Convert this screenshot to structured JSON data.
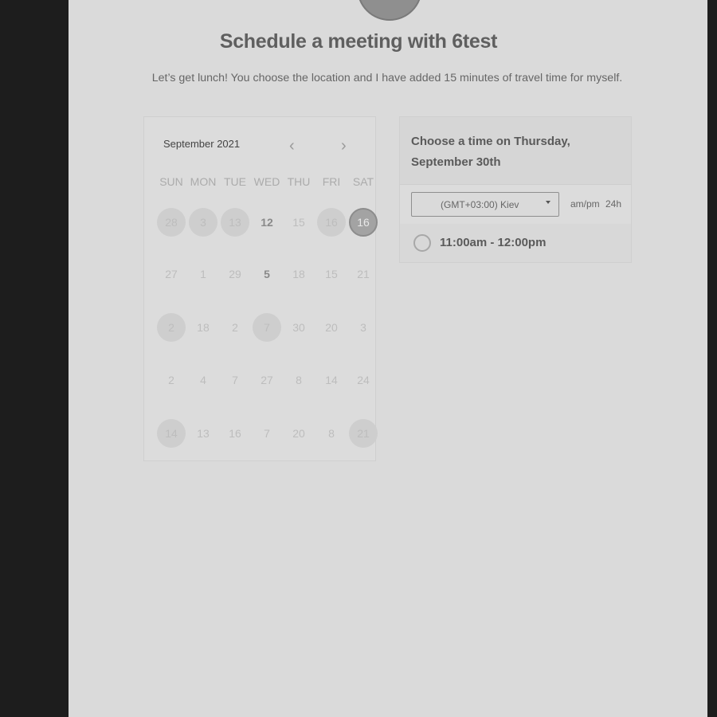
{
  "header": {
    "title": "Schedule a meeting with 6test",
    "subtitle": "Let’s get lunch! You choose the location and I have added 15 minutes of travel time for myself."
  },
  "calendar": {
    "month_label": "September 2021",
    "prev_icon": "chevron-left-icon",
    "next_icon": "chevron-right-icon",
    "weekdays": [
      "SUN",
      "MON",
      "TUE",
      "WED",
      "THU",
      "FRI",
      "SAT"
    ],
    "weeks": [
      [
        {
          "label": "28",
          "state": "shaded"
        },
        {
          "label": "3",
          "state": "shaded"
        },
        {
          "label": "13",
          "state": "shaded"
        },
        {
          "label": "12",
          "state": "bold"
        },
        {
          "label": "15",
          "state": "plain"
        },
        {
          "label": "16",
          "state": "shaded"
        },
        {
          "label": "16",
          "state": "selected"
        }
      ],
      [
        {
          "label": "27",
          "state": "plain"
        },
        {
          "label": "1",
          "state": "plain"
        },
        {
          "label": "29",
          "state": "plain"
        },
        {
          "label": "5",
          "state": "bold"
        },
        {
          "label": "18",
          "state": "plain"
        },
        {
          "label": "15",
          "state": "plain"
        },
        {
          "label": "21",
          "state": "plain"
        }
      ],
      [
        {
          "label": "2",
          "state": "shaded"
        },
        {
          "label": "18",
          "state": "plain"
        },
        {
          "label": "2",
          "state": "plain"
        },
        {
          "label": "7",
          "state": "shaded"
        },
        {
          "label": "30",
          "state": "plain"
        },
        {
          "label": "20",
          "state": "plain"
        },
        {
          "label": "3",
          "state": "plain"
        }
      ],
      [
        {
          "label": "2",
          "state": "plain"
        },
        {
          "label": "4",
          "state": "plain"
        },
        {
          "label": "7",
          "state": "plain"
        },
        {
          "label": "27",
          "state": "plain"
        },
        {
          "label": "8",
          "state": "plain"
        },
        {
          "label": "14",
          "state": "plain"
        },
        {
          "label": "24",
          "state": "plain"
        }
      ],
      [
        {
          "label": "14",
          "state": "shaded"
        },
        {
          "label": "13",
          "state": "plain"
        },
        {
          "label": "16",
          "state": "plain"
        },
        {
          "label": "7",
          "state": "plain"
        },
        {
          "label": "20",
          "state": "plain"
        },
        {
          "label": "8",
          "state": "plain"
        },
        {
          "label": "21",
          "state": "shaded"
        }
      ]
    ]
  },
  "time_panel": {
    "heading": "Choose a time on Thursday, September 30th",
    "timezone": "(GMT+03:00) Kiev",
    "timezone_icon": "caret-down-icon",
    "format_ampm": "am/pm",
    "format_24h": "24h",
    "slots": [
      {
        "label": "11:00am - 12:00pm",
        "selected": false
      }
    ]
  }
}
